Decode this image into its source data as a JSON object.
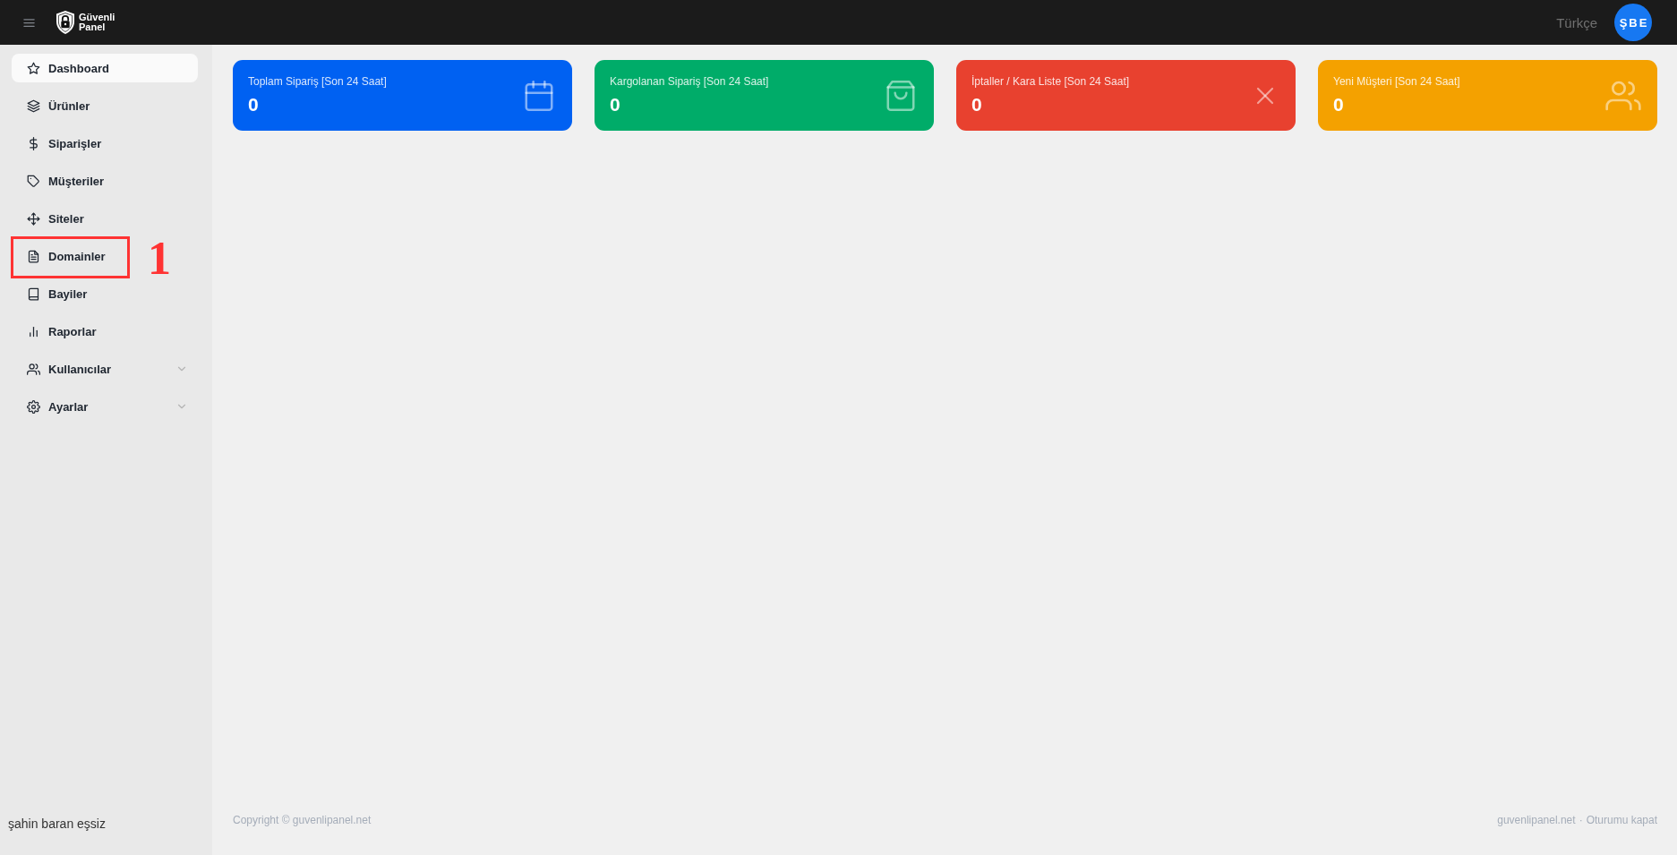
{
  "topbar": {
    "brand_name": "Güvenli Panel",
    "language": "Türkçe",
    "avatar_initials": "ŞBE"
  },
  "sidebar": {
    "items": [
      {
        "kind": "link",
        "label": "Dashboard",
        "selected": true
      },
      {
        "kind": "link",
        "label": "Ürünler",
        "selected": false
      },
      {
        "kind": "link",
        "label": "Siparişler",
        "selected": false
      },
      {
        "kind": "link",
        "label": "Müşteriler",
        "selected": false
      },
      {
        "kind": "link",
        "label": "Siteler",
        "selected": false
      },
      {
        "kind": "link",
        "label": "Domainler",
        "selected": false,
        "annotation": "1"
      },
      {
        "kind": "link",
        "label": "Bayiler",
        "selected": false
      },
      {
        "kind": "link",
        "label": "Raporlar",
        "selected": false
      },
      {
        "kind": "group",
        "label": "Kullanıcılar",
        "selected": false,
        "expanded": false
      },
      {
        "kind": "group",
        "label": "Ayarlar",
        "selected": false,
        "expanded": false
      }
    ],
    "user_name": "şahin baran eşsiz"
  },
  "stat_cards": [
    {
      "title": "Toplam Sipariş [Son 24 Saat]",
      "value": "0",
      "color": "#0061f2"
    },
    {
      "title": "Kargolanan Sipariş [Son 24 Saat]",
      "value": "0",
      "color": "#00ac69"
    },
    {
      "title": "İptaller / Kara Liste [Son 24 Saat]",
      "value": "0",
      "color": "#e8412f"
    },
    {
      "title": "Yeni Müşteri [Son 24 Saat]",
      "value": "0",
      "color": "#f4a100"
    }
  ],
  "footer": {
    "copyright": "Copyright © guvenlipanel.net",
    "links": [
      "guvenlipanel.net",
      "Oturumu kapat"
    ],
    "separator": "·"
  }
}
